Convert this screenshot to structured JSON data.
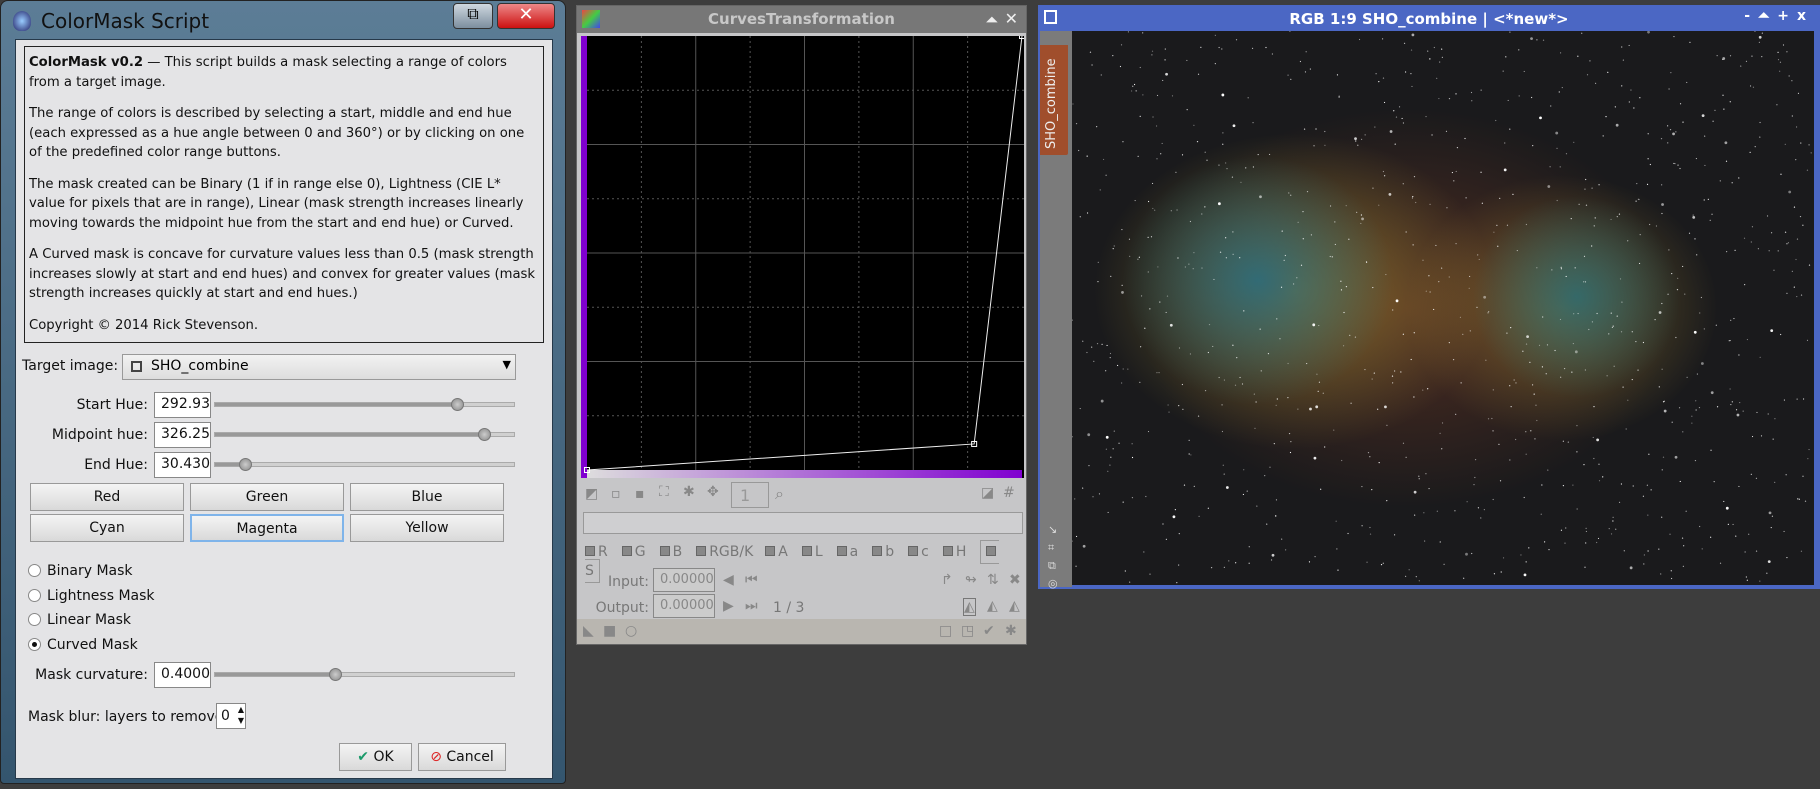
{
  "dialog": {
    "title": "ColorMask Script",
    "desc_bold": "ColorMask v0.2",
    "desc_p1": " — This script builds a mask selecting a range of colors from a target image.",
    "desc_p2": "The range of colors is described by selecting a start, middle and end hue (each expressed as a hue angle between 0 and 360°) or by clicking on one of the predefined color range buttons.",
    "desc_p3": "The mask created can be Binary (1 if in range else 0), Lightness (CIE L* value for pixels that are in range), Linear (mask strength increases linearly moving towards the midpoint hue from the start and end hue) or Curved.",
    "desc_p4": "A Curved mask is concave for curvature values less than 0.5 (mask strength increases slowly at start and end hues) and convex for greater values (mask strength increases quickly at start and end hues.)",
    "desc_p5": "Copyright © 2014 Rick Stevenson.",
    "target_label": "Target image:",
    "target_value": "SHO_combine",
    "hues": [
      {
        "label": "Start Hue:",
        "value": "292.93",
        "fraction": 0.8137
      },
      {
        "label": "Midpoint hue:",
        "value": "326.25",
        "fraction": 0.9063
      },
      {
        "label": "End Hue:",
        "value": "30.430",
        "fraction": 0.0845
      }
    ],
    "color_buttons": [
      "Red",
      "Green",
      "Blue",
      "Cyan",
      "Magenta",
      "Yellow"
    ],
    "selected_color": "Magenta",
    "mask_types": [
      "Binary Mask",
      "Lightness Mask",
      "Linear Mask",
      "Curved Mask"
    ],
    "selected_mask": "Curved Mask",
    "curvature_label": "Mask curvature:",
    "curvature_value": "0.4000",
    "curvature_fraction": 0.4,
    "blur_label": "Mask blur: layers to remove",
    "blur_value": "0",
    "ok": "OK",
    "cancel": "Cancel"
  },
  "curves": {
    "title": "CurvesTransformation",
    "zoom": "1",
    "channels": [
      "R",
      "G",
      "B",
      "RGB/K",
      "A",
      "L",
      "a",
      "b",
      "c",
      "H",
      "S"
    ],
    "active_channel": "S",
    "input_label": "Input:",
    "input_value": "0.00000",
    "output_label": "Output:",
    "output_value": "0.00000",
    "point_index": "1 / 3",
    "curve_points": [
      [
        0,
        0
      ],
      [
        0.89,
        0.06
      ],
      [
        1,
        1
      ]
    ]
  },
  "image_window": {
    "title": "RGB 1:9 SHO_combine | <*new*>",
    "side_tab": "SHO_combine",
    "accent": "#4b67c4"
  }
}
